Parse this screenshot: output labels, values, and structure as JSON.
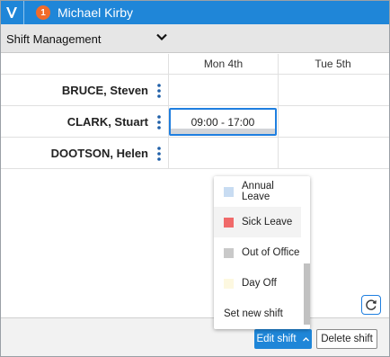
{
  "header": {
    "notification_count": "1",
    "user_name": "Michael Kirby",
    "logo_icon": "v-logo-icon",
    "colors": {
      "header_bg": "#1f86d8",
      "badge_bg": "#f26b2a"
    }
  },
  "module": {
    "selected": "Shift Management",
    "chevron_icon": "chevron-down-icon"
  },
  "schedule": {
    "columns": [
      "Mon 4th",
      "Tue 5th"
    ],
    "rows": [
      {
        "name": "BRUCE, Steven",
        "mon": "",
        "tue": ""
      },
      {
        "name": "CLARK, Stuart",
        "mon": "09:00 - 17:00",
        "tue": ""
      },
      {
        "name": "DOOTSON, Helen",
        "mon": "",
        "tue": ""
      }
    ],
    "colors": {
      "selected_border": "#1f7fe0"
    }
  },
  "menu": {
    "items": [
      {
        "label": "Annual Leave",
        "color": "#c8dcf2"
      },
      {
        "label": "Sick Leave",
        "color": "#f06a6a"
      },
      {
        "label": "Out of Office",
        "color": "#c9c9c9"
      },
      {
        "label": "Day Off",
        "color": "#fdf8e0"
      },
      {
        "label": "Set new shift",
        "color": ""
      }
    ]
  },
  "toolbar": {
    "edit_label": "Edit shift",
    "delete_label": "Delete shift",
    "refresh_icon": "refresh-icon"
  }
}
